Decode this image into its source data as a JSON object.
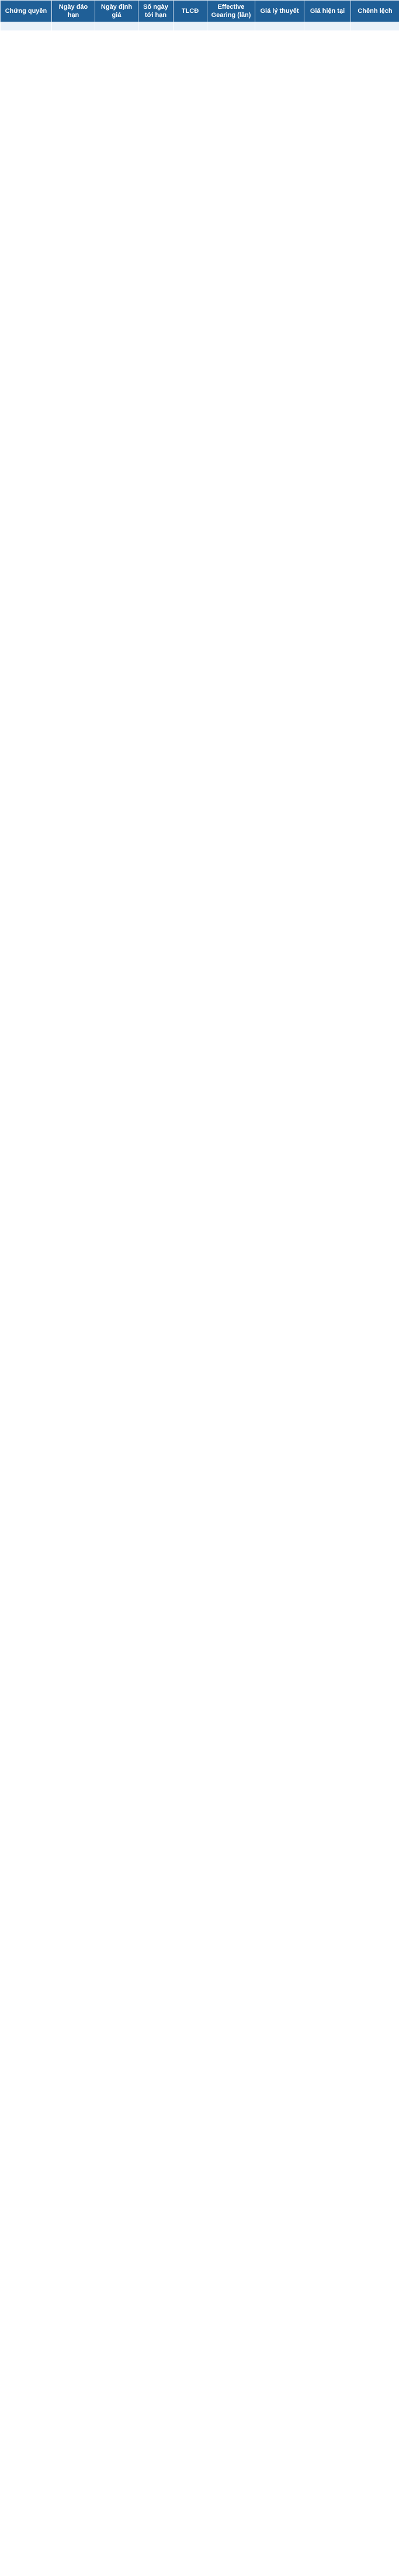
{
  "table": {
    "headers": [
      "Chứng quyền",
      "Ngày đáo hạn",
      "Ngày định giá",
      "Số ngày tới hạn",
      "TLCĐ",
      "Effective Gearing (lần)",
      "Giá lý thuyết",
      "Giá hiện tại",
      "Chênh lệch"
    ],
    "rows": [
      [
        "",
        "",
        "",
        "",
        "",
        "",
        "",
        "",
        ""
      ]
    ]
  }
}
